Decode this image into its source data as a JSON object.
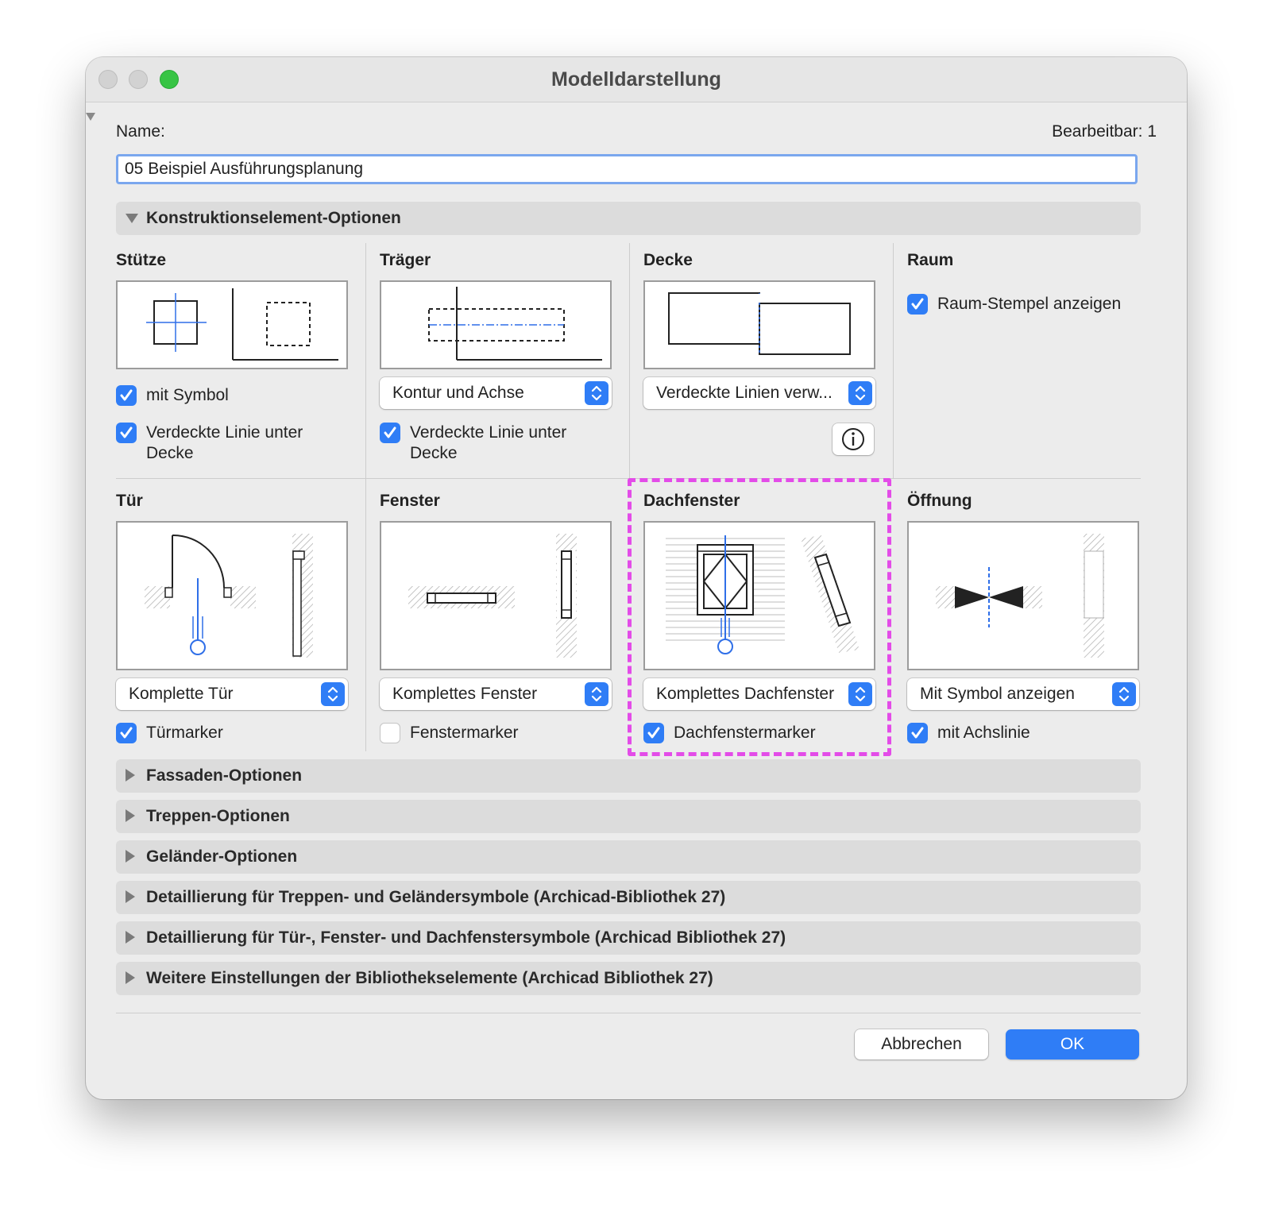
{
  "window": {
    "title": "Modelldarstellung"
  },
  "header": {
    "name_label": "Name:",
    "editable_label": "Bearbeitbar: 1"
  },
  "name_field": {
    "value": "05 Beispiel Ausführungsplanung"
  },
  "sections": {
    "construction": "Konstruktionselement-Optionen",
    "facade": "Fassaden-Optionen",
    "stairs": "Treppen-Optionen",
    "railing": "Geländer-Optionen",
    "detail_stairs": "Detaillierung für Treppen- und Geländersymbole (Archicad-Bibliothek 27)",
    "detail_doors": "Detaillierung für Tür-, Fenster- und Dachfenstersymbole (Archicad Bibliothek 27)",
    "further": "Weitere Einstellungen der Bibliothekselemente (Archicad Bibliothek 27)"
  },
  "columns": {
    "stuetze": {
      "title": "Stütze",
      "check1": {
        "label": "mit Symbol",
        "checked": true
      },
      "check2": {
        "label_line1": "Verdeckte Linie unter",
        "label_line2": "Decke",
        "checked": true
      }
    },
    "traeger": {
      "title": "Träger",
      "popup": "Kontur und Achse",
      "check1": {
        "label_line1": "Verdeckte Linie unter",
        "label_line2": "Decke",
        "checked": true
      }
    },
    "decke": {
      "title": "Decke",
      "popup": "Verdeckte Linien verw...",
      "info_icon": "info-icon"
    },
    "raum": {
      "title": "Raum",
      "check1": {
        "label": "Raum-Stempel anzeigen",
        "checked": true
      }
    },
    "tuer": {
      "title": "Tür",
      "popup": "Komplette Tür",
      "check1": {
        "label": "Türmarker",
        "checked": true
      }
    },
    "fenster": {
      "title": "Fenster",
      "popup": "Komplettes Fenster",
      "check1": {
        "label": "Fenstermarker",
        "checked": false
      }
    },
    "dachfenster": {
      "title": "Dachfenster",
      "popup": "Komplettes Dachfenster",
      "check1": {
        "label": "Dachfenstermarker",
        "checked": true
      }
    },
    "oeffnung": {
      "title": "Öffnung",
      "popup": "Mit Symbol anzeigen",
      "check1": {
        "label": "mit Achslinie",
        "checked": true
      }
    }
  },
  "buttons": {
    "cancel": "Abbrechen",
    "ok": "OK"
  },
  "colors": {
    "accent": "#2f7df6",
    "highlight": "#e34ce8",
    "axis_blue": "#2f6fe8"
  }
}
